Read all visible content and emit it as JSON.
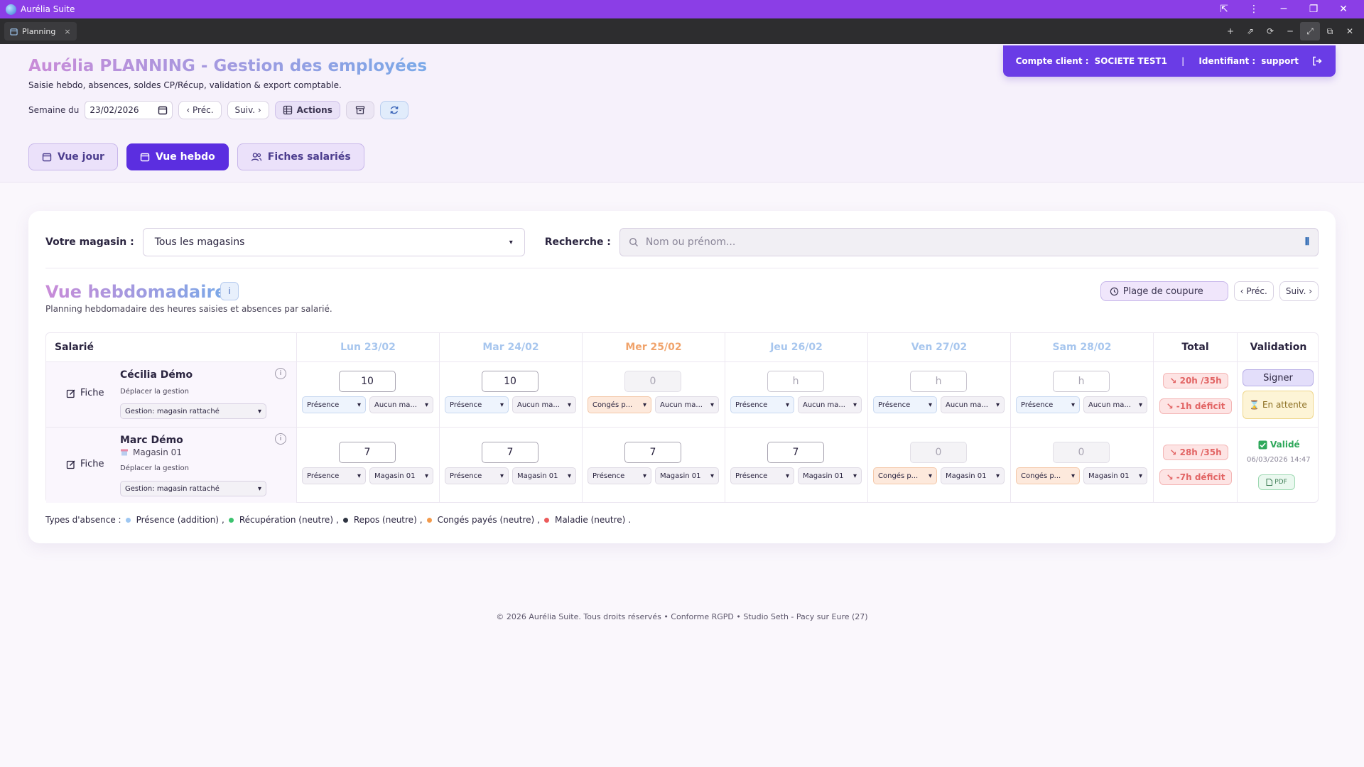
{
  "window": {
    "title": "Aurélia Suite",
    "tab_label": "Planning",
    "tab_close": "×",
    "controls": [
      "⇱",
      "⋮",
      "─",
      "❐",
      "✕"
    ],
    "tab_tools": [
      "+",
      "⇗",
      "⟳",
      "─",
      "⤢",
      "⧉",
      "✕"
    ]
  },
  "header": {
    "title": "Aurélia PLANNING - Gestion des employées",
    "subtitle": "Saisie hebdo, absences, soldes CP/Récup, validation & export comptable.",
    "week_label": "Semaine du",
    "week_date": "23/02/2026",
    "prev_label": "‹ Préc.",
    "next_label": "Suiv. ›",
    "actions_label": "Actions",
    "views": [
      "Vue jour",
      "Vue hebdo",
      "Fiches salariés"
    ],
    "account": {
      "client_label": "Compte client :",
      "client_value": "SOCIETE TEST1",
      "sep": "|",
      "id_label": "Identifiant :",
      "id_value": "support"
    }
  },
  "filters": {
    "store_label": "Votre magasin :",
    "store_value": "Tous les magasins",
    "search_label": "Recherche :",
    "search_placeholder": "Nom ou prénom..."
  },
  "section": {
    "title": "Vue hebdomadaire",
    "info": "i",
    "subtitle": "Planning hebdomadaire des heures saisies et absences par salarié.",
    "plage_label": "Plage de coupure",
    "prev_label": "‹ Préc.",
    "next_label": "Suiv. ›"
  },
  "table": {
    "headers": {
      "employee": "Salarié",
      "days": [
        "Lun 23/02",
        "Mar 24/02",
        "Mer 25/02",
        "Jeu 26/02",
        "Ven 27/02",
        "Sam 28/02"
      ],
      "total": "Total",
      "validation": "Validation"
    },
    "fiche_label": "Fiche",
    "move_label": "Déplacer la gestion",
    "gestion_value": "Gestion: magasin rattaché",
    "rows": [
      {
        "name": "Cécilia Démo",
        "store": "",
        "hours": [
          "10",
          "10",
          "0",
          "h",
          "h",
          "h"
        ],
        "types": [
          "Présence",
          "Présence",
          "Congés p...",
          "Présence",
          "Présence",
          "Présence"
        ],
        "stores": [
          "Aucun ma...",
          "Aucun ma...",
          "Aucun ma...",
          "Aucun ma...",
          "Aucun ma...",
          "Aucun ma..."
        ],
        "total": "↘ 20h /35h",
        "deficit": "↘ -1h  déficit",
        "sign_label": "Signer",
        "pending_label": "⌛ En attente"
      },
      {
        "name": "Marc Démo",
        "store": "Magasin 01",
        "hours": [
          "7",
          "7",
          "7",
          "7",
          "0",
          "0"
        ],
        "types": [
          "Présence",
          "Présence",
          "Présence",
          "Présence",
          "Congés p...",
          "Congés p..."
        ],
        "stores": [
          "Magasin 01",
          "Magasin 01",
          "Magasin 01",
          "Magasin 01",
          "Magasin 01",
          "Magasin 01"
        ],
        "total": "↘ 28h /35h",
        "deficit": "↘ -7h  déficit",
        "validated_label": "Validé",
        "validated_date": "06/03/2026 14:47",
        "pdf_label": "PDF"
      }
    ]
  },
  "legend": {
    "label": "Types d'absence :",
    "items": [
      {
        "label": "Présence (addition)",
        "color": "#9ec7f2"
      },
      {
        "label": "Récupération (neutre)",
        "color": "#3cc36f"
      },
      {
        "label": "Repos (neutre)",
        "color": "#2f3542"
      },
      {
        "label": "Congés payés (neutre)",
        "color": "#f39a4c"
      },
      {
        "label": "Maladie (neutre)",
        "color": "#ec5b5b"
      }
    ],
    "end": "."
  },
  "footer": "© 2026 Aurélia Suite. Tous droits réservés • Conforme RGPD • Studio Seth - Pacy sur Eure (27)"
}
